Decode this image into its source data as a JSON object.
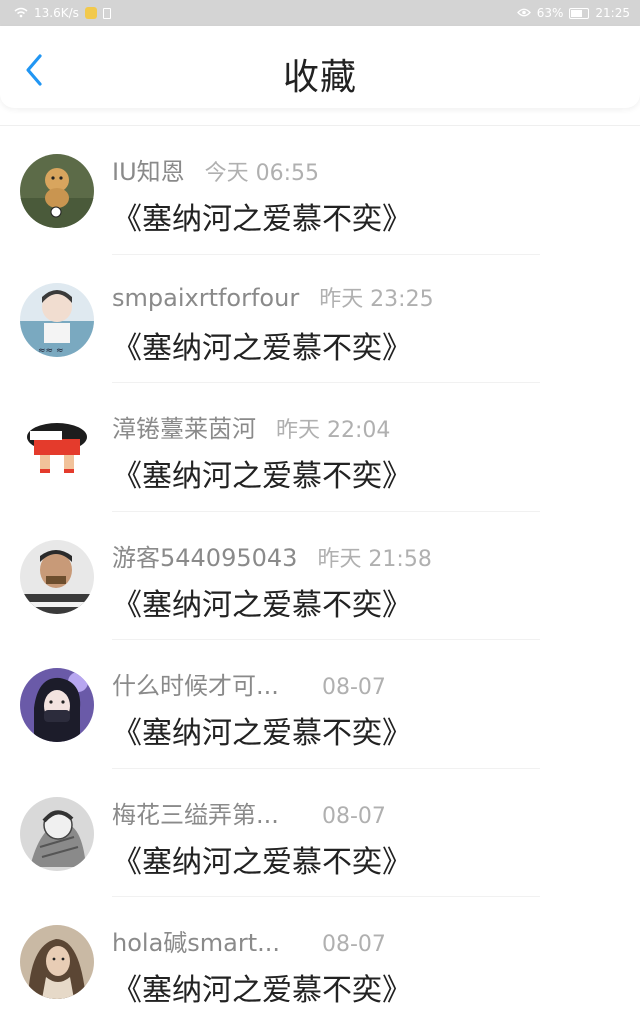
{
  "status_bar": {
    "network_speed": "13.6K/s",
    "battery": "63%",
    "time": "21:25"
  },
  "header": {
    "title": "收藏",
    "back_icon": "chevron-left-icon",
    "accent_color": "#2196F3"
  },
  "favorites": [
    {
      "user": "IU知恩",
      "time": "今天 06:55",
      "content": "《塞纳河之爱慕不奕》"
    },
    {
      "user": "smpaixrtforfour",
      "time": "昨天 23:25",
      "content": "《塞纳河之爱慕不奕》"
    },
    {
      "user": "漳锩薹莱茵河",
      "time": "昨天 22:04",
      "content": "《塞纳河之爱慕不奕》"
    },
    {
      "user": "游客544095043",
      "time": "昨天 21:58",
      "content": "《塞纳河之爱慕不奕》"
    },
    {
      "user": "什么时候才可...",
      "time": "08-07",
      "content": "《塞纳河之爱慕不奕》"
    },
    {
      "user": "梅花三缢弄第...",
      "time": "08-07",
      "content": "《塞纳河之爱慕不奕》"
    },
    {
      "user": "hola碱smart...",
      "time": "08-07",
      "content": "《塞纳河之爱慕不奕》"
    }
  ]
}
